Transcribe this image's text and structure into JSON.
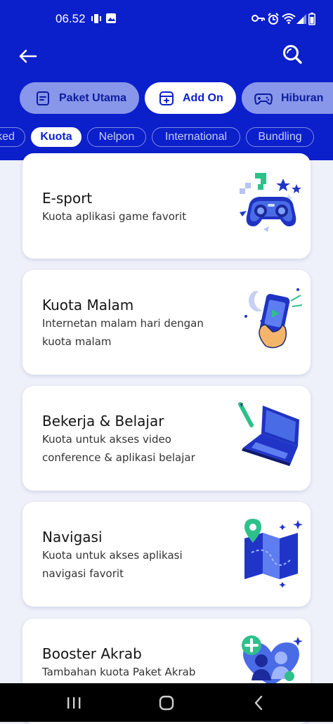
{
  "status_bar": {
    "time": "06.52"
  },
  "main_tabs": [
    {
      "label": "Paket Utama",
      "icon": "package-icon",
      "active": false
    },
    {
      "label": "Add On",
      "icon": "add-on-icon",
      "active": true
    },
    {
      "label": "Hiburan",
      "icon": "gamepad-icon",
      "active": false
    }
  ],
  "sub_tabs": [
    {
      "label": "ked",
      "active": false
    },
    {
      "label": "Kuota",
      "active": true
    },
    {
      "label": "Nelpon",
      "active": false
    },
    {
      "label": "International",
      "active": false
    },
    {
      "label": "Bundling",
      "active": false
    }
  ],
  "cards": [
    {
      "title": "E-sport",
      "description": "Kuota aplikasi game favorit",
      "illustration": "gamepad-illustration"
    },
    {
      "title": "Kuota Malam",
      "description": "Internetan malam hari dengan kuota malam",
      "illustration": "night-phone-illustration"
    },
    {
      "title": "Bekerja & Belajar",
      "description": "Kuota untuk akses video conference & aplikasi belajar",
      "illustration": "laptop-illustration"
    },
    {
      "title": "Navigasi",
      "description": "Kuota untuk akses aplikasi navigasi favorit",
      "illustration": "map-illustration"
    },
    {
      "title": "Booster Akrab",
      "description": "Tambahan kuota Paket Akrab",
      "illustration": "family-heart-illustration"
    }
  ],
  "colors": {
    "primary": "#0b1fcb",
    "background": "#eef0fa",
    "card": "#ffffff"
  }
}
